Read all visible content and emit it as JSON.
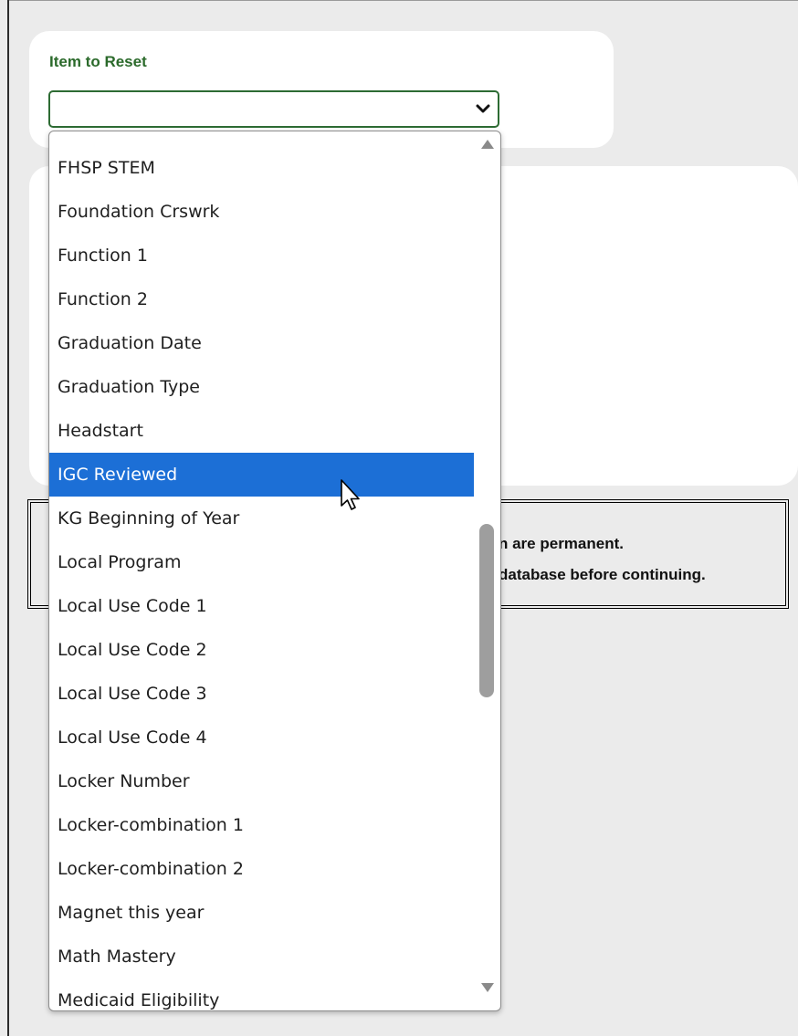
{
  "form": {
    "item_to_reset_label": "Item to Reset",
    "selected_value": ""
  },
  "warning": {
    "line1": "n are permanent.",
    "line2": "database before continuing."
  },
  "dropdown": {
    "items": [
      {
        "label": "FHSP STEM",
        "selected": false
      },
      {
        "label": "Foundation Crswrk",
        "selected": false
      },
      {
        "label": "Function 1",
        "selected": false
      },
      {
        "label": "Function 2",
        "selected": false
      },
      {
        "label": "Graduation Date",
        "selected": false
      },
      {
        "label": "Graduation Type",
        "selected": false
      },
      {
        "label": "Headstart",
        "selected": false
      },
      {
        "label": "IGC Reviewed",
        "selected": true
      },
      {
        "label": "KG Beginning of Year",
        "selected": false
      },
      {
        "label": "Local Program",
        "selected": false
      },
      {
        "label": "Local Use Code 1",
        "selected": false
      },
      {
        "label": "Local Use Code 2",
        "selected": false
      },
      {
        "label": "Local Use Code 3",
        "selected": false
      },
      {
        "label": "Local Use Code 4",
        "selected": false
      },
      {
        "label": "Locker Number",
        "selected": false
      },
      {
        "label": "Locker-combination 1",
        "selected": false
      },
      {
        "label": "Locker-combination 2",
        "selected": false
      },
      {
        "label": "Magnet this year",
        "selected": false
      },
      {
        "label": "Math Mastery",
        "selected": false
      },
      {
        "label": "Medicaid Eligibility",
        "selected": false
      }
    ]
  },
  "colors": {
    "label_green": "#2b6a2b",
    "select_border": "#2d6b33",
    "highlight": "#1c6fd6",
    "background": "#ebebeb"
  },
  "icons": {
    "select_arrow": "chevron-down-icon",
    "scroll_up": "scroll-up-arrow-icon",
    "scroll_down": "scroll-down-arrow-icon",
    "cursor": "mouse-pointer-icon"
  }
}
